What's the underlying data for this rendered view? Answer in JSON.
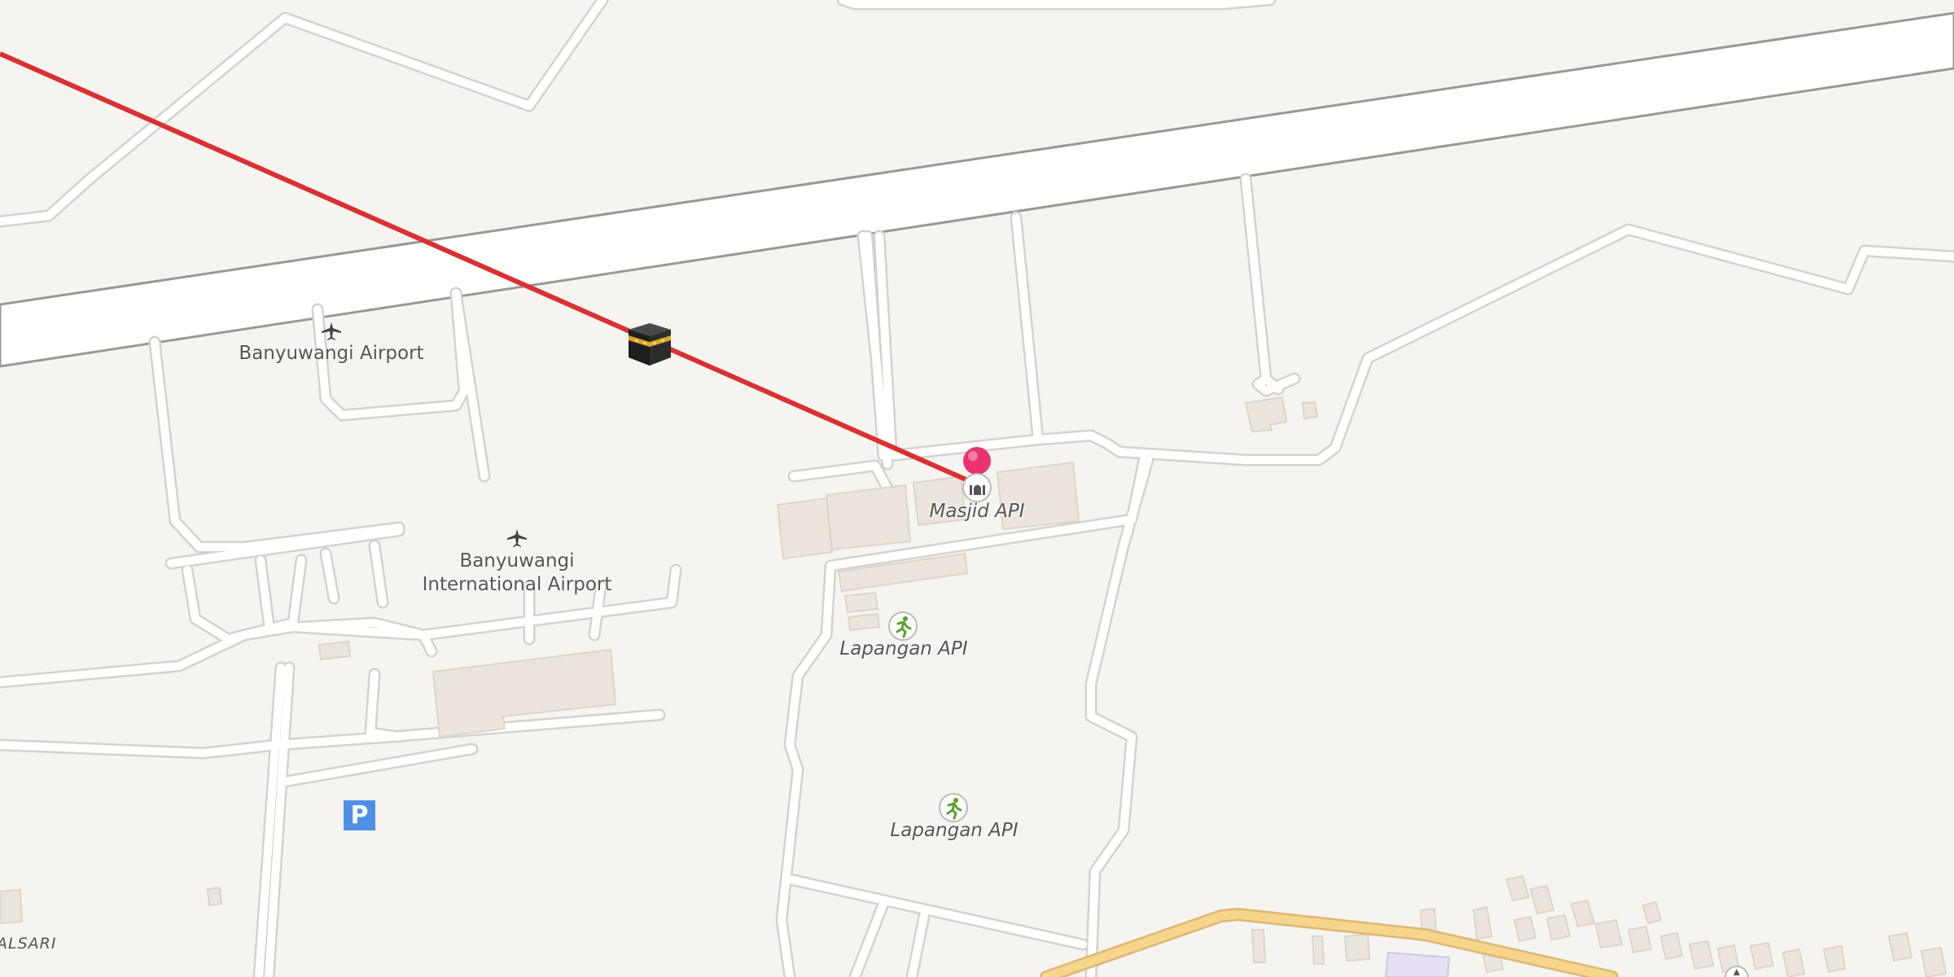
{
  "map": {
    "background_color": "#f6f4f0",
    "runway_color": "#ffffff",
    "road_outline_color": "#d2d0cc",
    "building_color": "#ebe5de",
    "major_road_color": "#f6d58c",
    "qibla_line_color": "#d93030",
    "marker_color": "#e8336e"
  },
  "labels": {
    "airport": "Banyuwangi Airport",
    "international_airport": "Banyuwangi\nInternational Airport",
    "mosque": "Masjid API",
    "field_1": "Lapangan API",
    "field_2": "Lapangan API",
    "parking": "P",
    "village_partial": "ALSARI"
  },
  "icons": {
    "kaaba": "kaaba-icon",
    "marker": "location-pin-icon",
    "mosque": "mosque-icon",
    "sports": "sports-field-icon",
    "airport": "airplane-icon",
    "parking": "parking-icon"
  }
}
